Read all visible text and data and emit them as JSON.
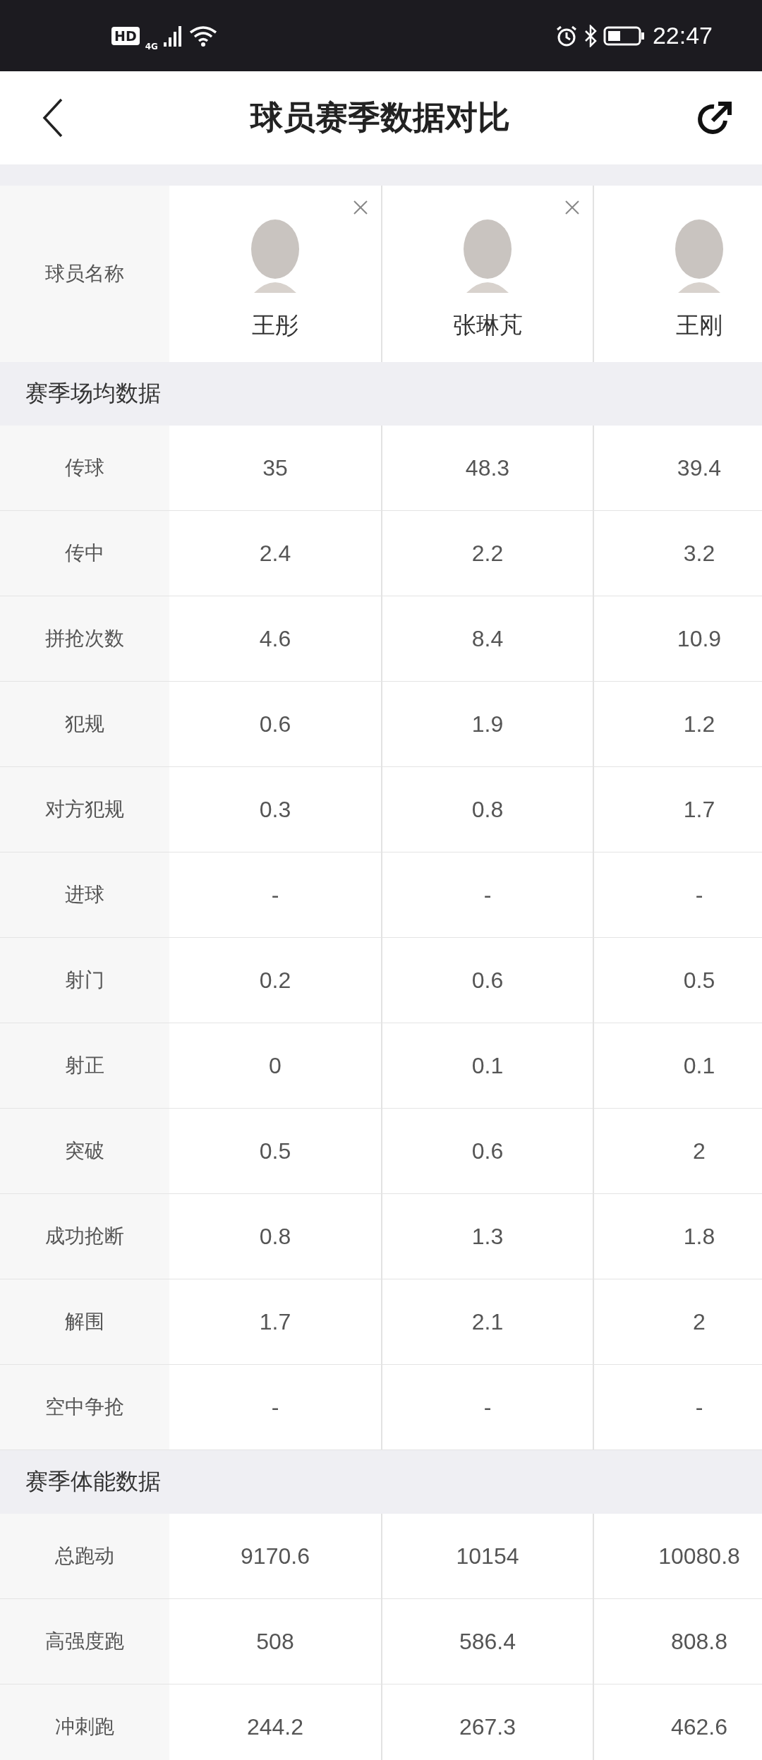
{
  "status_bar": {
    "time": "22:47",
    "network": "4G",
    "hd": "HD"
  },
  "header": {
    "title": "球员赛季数据对比"
  },
  "players": {
    "label": "球员名称",
    "items": [
      {
        "name": "王彤",
        "removable": true
      },
      {
        "name": "张琳芃",
        "removable": true
      },
      {
        "name": "王刚",
        "removable": false
      }
    ]
  },
  "sections": [
    {
      "title": "赛季场均数据",
      "rows": [
        {
          "label": "传球",
          "values": [
            "35",
            "48.3",
            "39.4"
          ]
        },
        {
          "label": "传中",
          "values": [
            "2.4",
            "2.2",
            "3.2"
          ]
        },
        {
          "label": "拼抢次数",
          "values": [
            "4.6",
            "8.4",
            "10.9"
          ]
        },
        {
          "label": "犯规",
          "values": [
            "0.6",
            "1.9",
            "1.2"
          ]
        },
        {
          "label": "对方犯规",
          "values": [
            "0.3",
            "0.8",
            "1.7"
          ]
        },
        {
          "label": "进球",
          "values": [
            "-",
            "-",
            "-"
          ]
        },
        {
          "label": "射门",
          "values": [
            "0.2",
            "0.6",
            "0.5"
          ]
        },
        {
          "label": "射正",
          "values": [
            "0",
            "0.1",
            "0.1"
          ]
        },
        {
          "label": "突破",
          "values": [
            "0.5",
            "0.6",
            "2"
          ]
        },
        {
          "label": "成功抢断",
          "values": [
            "0.8",
            "1.3",
            "1.8"
          ]
        },
        {
          "label": "解围",
          "values": [
            "1.7",
            "2.1",
            "2"
          ]
        },
        {
          "label": "空中争抢",
          "values": [
            "-",
            "-",
            "-"
          ]
        }
      ]
    },
    {
      "title": "赛季体能数据",
      "rows": [
        {
          "label": "总跑动",
          "values": [
            "9170.6",
            "10154",
            "10080.8"
          ]
        },
        {
          "label": "高强度跑",
          "values": [
            "508",
            "586.4",
            "808.8"
          ]
        },
        {
          "label": "冲刺跑",
          "values": [
            "244.2",
            "267.3",
            "462.6"
          ]
        }
      ]
    }
  ]
}
